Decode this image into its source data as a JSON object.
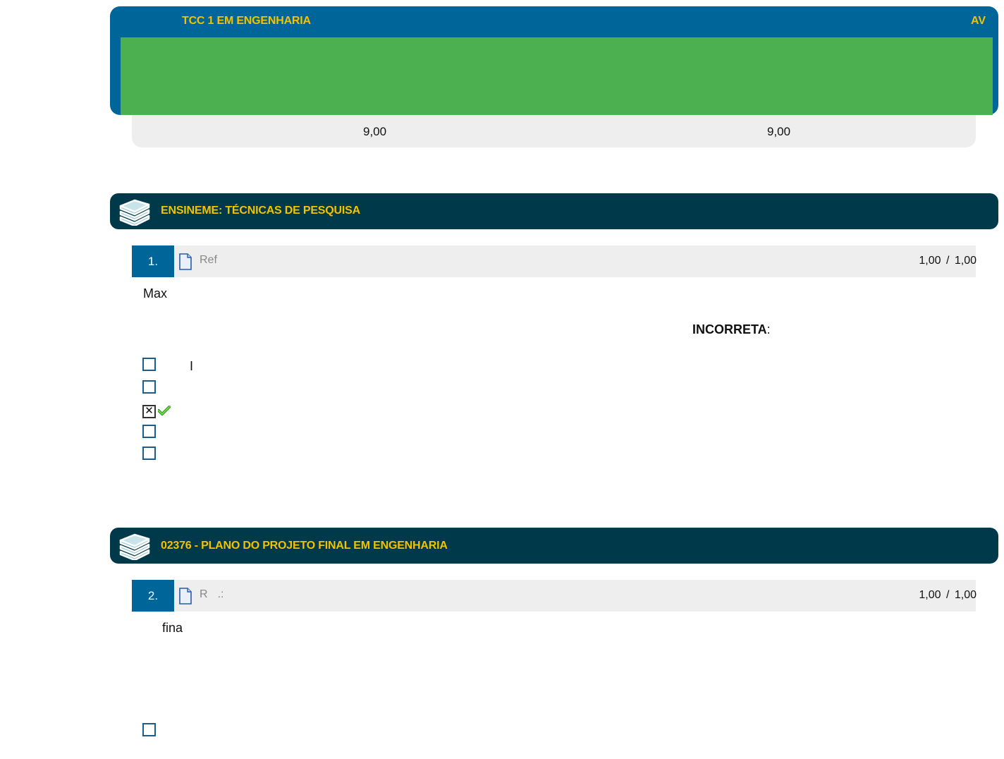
{
  "top": {
    "course_title": "TCC 1 EM ENGENHARIA",
    "av_label": "AV",
    "score_left": "9,00",
    "score_right": "9,00"
  },
  "sections": [
    {
      "title": "ENSINEME: TÉCNICAS DE PESQUISA",
      "question": {
        "number": "1.",
        "ref": "Ref",
        "score": "1,00",
        "score_sep": "/",
        "score_max": "1,00",
        "text_start": "Max",
        "emphasis": "INCORRETA",
        "emphasis_colon": ":",
        "option_1_text": "I",
        "options": [
          {
            "checked": false
          },
          {
            "checked": false
          },
          {
            "checked": true,
            "correct": true
          },
          {
            "checked": false
          },
          {
            "checked": false
          }
        ]
      }
    },
    {
      "title": "02376 - PLANO DO PROJETO FINAL EM ENGENHARIA",
      "question": {
        "number": "2.",
        "ref": "R",
        "ref_suffix": ".:",
        "score": "1,00",
        "score_sep": "/",
        "score_max": "1,00",
        "text_start": "fina",
        "options": [
          {
            "checked": false
          }
        ]
      }
    }
  ],
  "colors": {
    "primary_blue": "#00669a",
    "dark_teal": "#003a4a",
    "accent_yellow": "#f2c200",
    "green": "#4caf50",
    "strip_gray": "#eeeeee"
  },
  "icons": {
    "section": "books-icon",
    "question": "document-icon",
    "correct": "check-mark-icon"
  }
}
